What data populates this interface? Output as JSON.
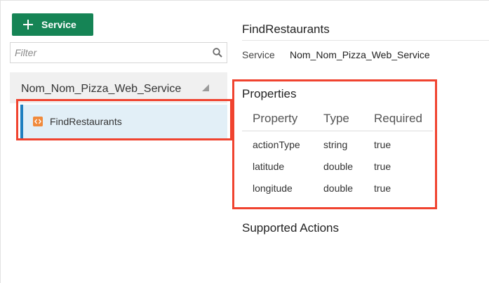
{
  "toolbar": {
    "add_service_label": "Service"
  },
  "filter": {
    "placeholder": "Filter",
    "value": ""
  },
  "tree": {
    "group_label": "Nom_Nom_Pizza_Web_Service",
    "selected_item": "FindRestaurants"
  },
  "detail": {
    "title": "FindRestaurants",
    "service_label": "Service",
    "service_value": "Nom_Nom_Pizza_Web_Service",
    "properties_title": "Properties",
    "columns": [
      "Property",
      "Type",
      "Required"
    ],
    "rows": [
      {
        "property": "actionType",
        "type": "string",
        "required": "true"
      },
      {
        "property": "latitude",
        "type": "double",
        "required": "true"
      },
      {
        "property": "longitude",
        "type": "double",
        "required": "true"
      }
    ],
    "actions_title": "Supported Actions"
  },
  "colors": {
    "primary_button": "#158455",
    "selection_accent": "#1e7fc0",
    "highlight": "#f0432f",
    "api_icon": "#f08a3c"
  }
}
